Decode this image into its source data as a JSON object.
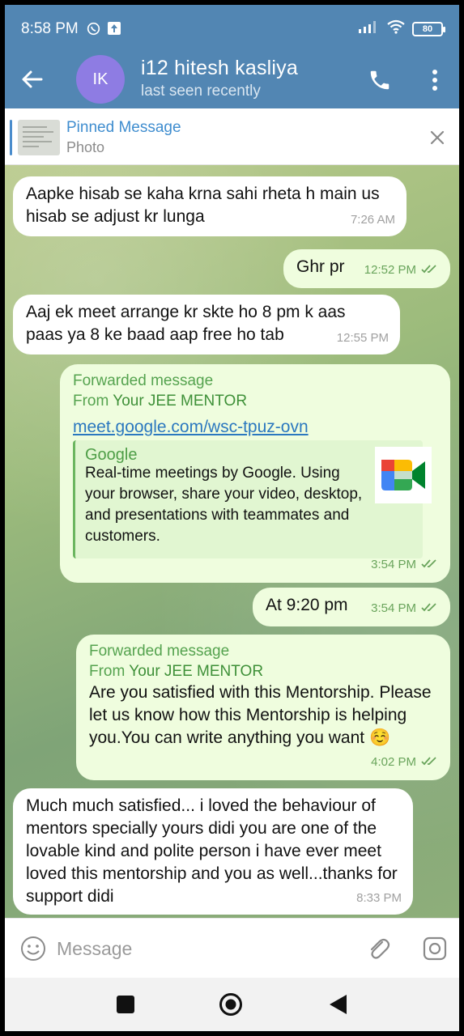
{
  "status_bar": {
    "time": "8:58 PM",
    "battery": "80"
  },
  "header": {
    "avatar_initials": "IK",
    "title": "i12 hitesh kasliya",
    "subtitle": "last seen recently"
  },
  "pinned": {
    "title": "Pinned Message",
    "subtitle": "Photo"
  },
  "messages": [
    {
      "direction": "in",
      "text": "Aapke hisab se kaha krna sahi rheta h main us hisab se adjust kr lunga",
      "time": "7:26 AM"
    },
    {
      "direction": "out",
      "text": "Ghr pr",
      "time": "12:52 PM"
    },
    {
      "direction": "in",
      "text": "Aaj ek meet arrange kr skte ho 8 pm k aas paas ya 8 ke baad aap free ho tab",
      "time": "12:55 PM"
    },
    {
      "direction": "out",
      "forwarded_label": "Forwarded message",
      "from_prefix": "From ",
      "from_name": "Your JEE MENTOR",
      "link": "meet.google.com/wsc-tpuz-ovn",
      "preview_site": "Google",
      "preview_desc": "Real-time meetings by Google. Using your browser, share your video, desktop, and presentations with teammates and customers.",
      "time": "3:54 PM"
    },
    {
      "direction": "out",
      "text": "At 9:20 pm",
      "time": "3:54 PM"
    },
    {
      "direction": "out",
      "forwarded_label": "Forwarded message",
      "from_prefix": "From ",
      "from_name": "Your JEE MENTOR",
      "text": "Are you satisfied with this Mentorship. Please let us know how this Mentorship is helping you.You can write anything you want ☺️",
      "time": "4:02 PM"
    },
    {
      "direction": "in",
      "text": "Much much satisfied... i loved the behaviour of mentors specially yours didi you are one of the lovable kind and polite person i have ever meet loved this mentorship and you as well...thanks for support didi",
      "time": "8:33 PM"
    }
  ],
  "composer": {
    "placeholder": "Message"
  },
  "colors": {
    "header": "#5286b3",
    "outgoing_bubble": "#effdde",
    "incoming_bubble": "#ffffff",
    "accent": "#3f8dcf"
  }
}
